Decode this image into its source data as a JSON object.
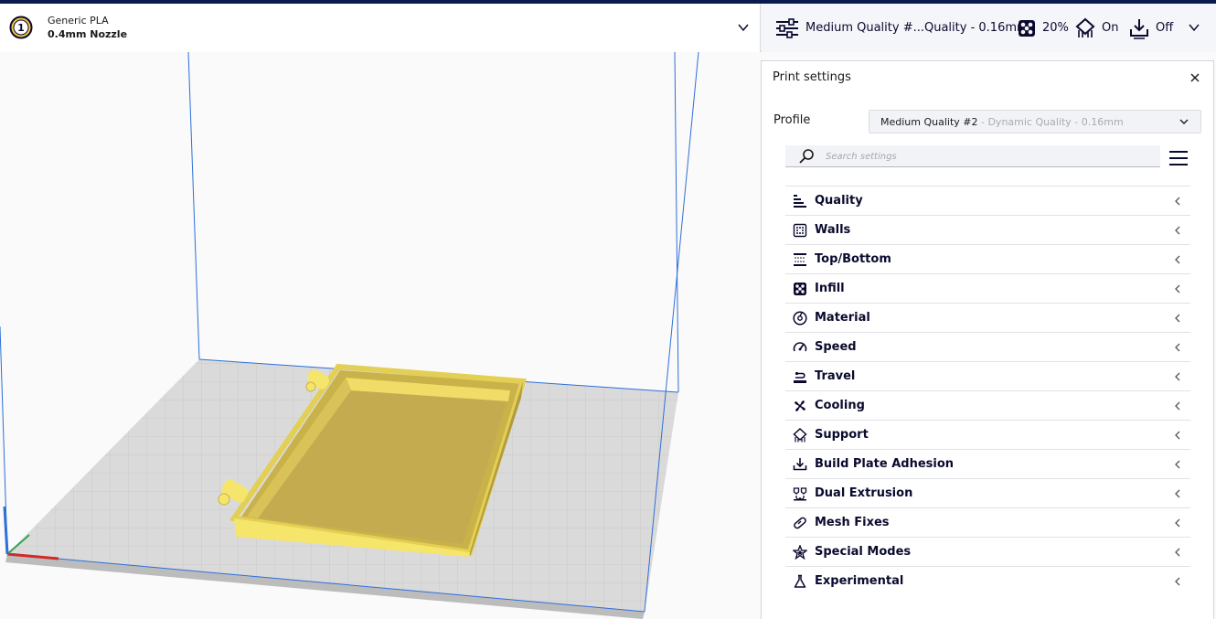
{
  "extruder": {
    "number": "1",
    "material": "Generic PLA",
    "nozzle": "0.4mm Nozzle"
  },
  "summary": {
    "profile": "Medium Quality #...Quality - 0.16mm",
    "infill": "20%",
    "support": "On",
    "adhesion": "Off"
  },
  "print_settings": {
    "title": "Print settings",
    "profile_label": "Profile",
    "profile_name": "Medium Quality #2",
    "profile_detail": " - Dynamic Quality - 0.16mm",
    "search_placeholder": "Search settings",
    "categories": [
      {
        "label": "Quality",
        "icon": "quality-icon"
      },
      {
        "label": "Walls",
        "icon": "walls-icon"
      },
      {
        "label": "Top/Bottom",
        "icon": "top-bottom-icon"
      },
      {
        "label": "Infill",
        "icon": "infill-icon"
      },
      {
        "label": "Material",
        "icon": "material-icon"
      },
      {
        "label": "Speed",
        "icon": "speed-icon"
      },
      {
        "label": "Travel",
        "icon": "travel-icon"
      },
      {
        "label": "Cooling",
        "icon": "cooling-icon"
      },
      {
        "label": "Support",
        "icon": "support-icon"
      },
      {
        "label": "Build Plate Adhesion",
        "icon": "build-plate-adhesion-icon"
      },
      {
        "label": "Dual Extrusion",
        "icon": "dual-extrusion-icon"
      },
      {
        "label": "Mesh Fixes",
        "icon": "mesh-fixes-icon"
      },
      {
        "label": "Special Modes",
        "icon": "special-modes-icon"
      },
      {
        "label": "Experimental",
        "icon": "experimental-icon"
      }
    ]
  },
  "colors": {
    "accent_dark": "#0a0a2e",
    "model_yellow": "#f6e56b",
    "build_volume_line": "#2e6fd8",
    "plate_grey": "#d9d9d9"
  }
}
